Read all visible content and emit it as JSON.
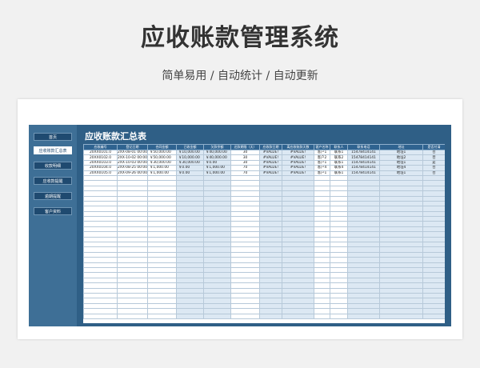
{
  "page": {
    "title": "应收账款管理系统",
    "subtitle": "简单易用 / 自动统计 / 自动更新"
  },
  "sidebar": {
    "items": [
      {
        "label": "首页",
        "active": false
      },
      {
        "label": "应收账款汇总表",
        "active": true
      },
      {
        "label": "收款明细",
        "active": false
      },
      {
        "label": "应收款提醒",
        "active": false
      },
      {
        "label": "逾期提醒",
        "active": false
      },
      {
        "label": "客户资料",
        "active": false
      }
    ]
  },
  "sheet": {
    "title": "应收账款汇总表",
    "columns": [
      "应收编号",
      "登记日期",
      "合同金额",
      "已收金额",
      "欠款余额",
      "还款期限（天）",
      "应收款日期",
      "离应收账款天数",
      "客户名称",
      "联系人",
      "联系电话",
      "地址",
      "是否付清"
    ],
    "rows": [
      [
        "20XX0101.0",
        "2XX-08-01 00:00",
        "￥50,000.00",
        "￥10,000.00",
        "￥40,000.00",
        "30",
        "#VALUE!",
        "#VALUE!",
        "客户1",
        "联系1",
        "15478414141",
        "地址1",
        "否"
      ],
      [
        "20XX0102.0",
        "2XX-10-02 00:00",
        "￥50,000.00",
        "￥10,000.00",
        "￥40,000.00",
        "30",
        "#VALUE!",
        "#VALUE!",
        "客户2",
        "联系2",
        "15478414141",
        "地址2",
        "否"
      ],
      [
        "20XX0103.0",
        "2XX-10-03 00:00",
        "￥30,000.00",
        "￥30,000.00",
        "￥0.00",
        "30",
        "#VALUE!",
        "#VALUE!",
        "客户1",
        "联系1",
        "15478414141",
        "地址1",
        "是"
      ],
      [
        "20XX0104.0",
        "2XX-08-25 00:00",
        "￥1,000.00",
        "￥0.00",
        "￥1,000.00",
        "70",
        "#VALUE!",
        "#VALUE!",
        "客户4",
        "联系4",
        "15478414141",
        "地址4",
        "否"
      ],
      [
        "20XX0105.0",
        "2XX-09-26 00:00",
        "￥1,000.00",
        "￥0.00",
        "￥1,000.00",
        "70",
        "#VALUE!",
        "#VALUE!",
        "客户1",
        "联系1",
        "15478414141",
        "地址1",
        "否"
      ]
    ],
    "empty_rows": 28
  }
}
